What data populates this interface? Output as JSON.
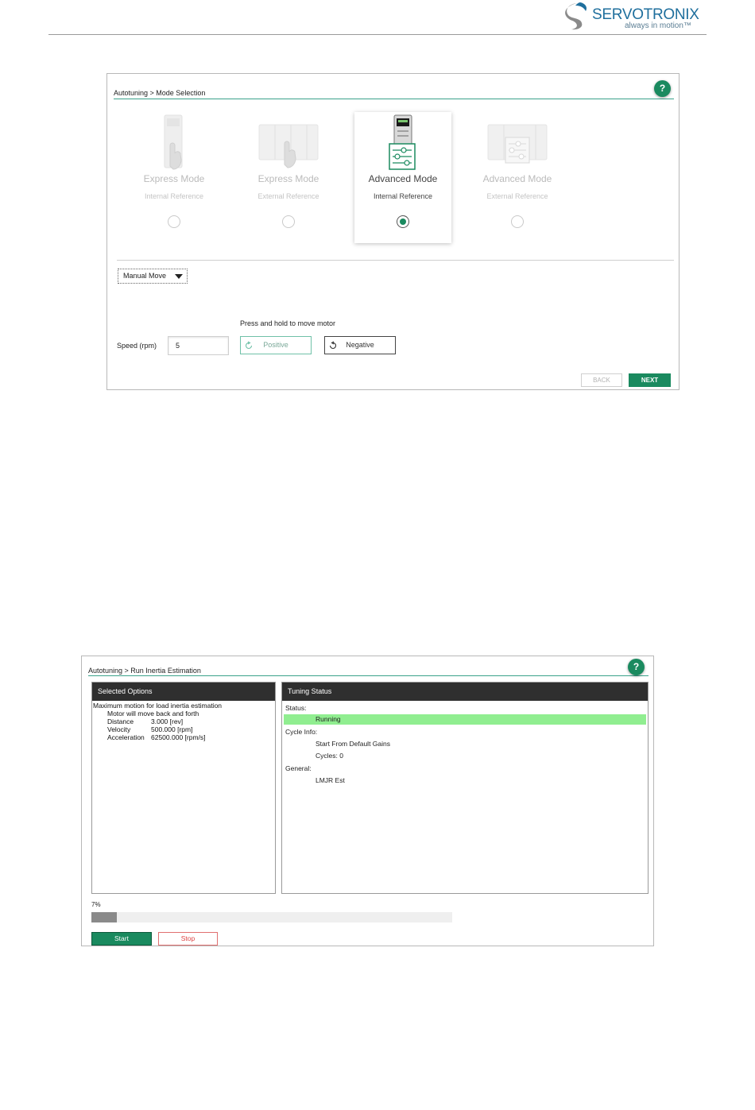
{
  "header": {
    "brand_name": "SERVOTRONIX",
    "tagline": "always in motion™",
    "brand_color": "#1f6f9d"
  },
  "mode_selection": {
    "breadcrumb": "Autotuning > Mode Selection",
    "help_label": "?",
    "modes": [
      {
        "title": "Express Mode",
        "subtitle": "Internal Reference",
        "selected": false
      },
      {
        "title": "Express Mode",
        "subtitle": "External Reference",
        "selected": false
      },
      {
        "title": "Advanced Mode",
        "subtitle": "Internal Reference",
        "selected": true
      },
      {
        "title": "Advanced Mode",
        "subtitle": "External Reference",
        "selected": false
      }
    ],
    "motion_dropdown": "Manual Move",
    "hint": "Press and hold to move motor",
    "speed_label": "Speed (rpm)",
    "speed_value": "5",
    "positive_label": "Positive",
    "negative_label": "Negative",
    "back_label": "BACK",
    "next_label": "NEXT",
    "accent_color": "#1a8a5f"
  },
  "inertia": {
    "breadcrumb": "Autotuning > Run Inertia Estimation",
    "help_label": "?",
    "selected_options": {
      "title": "Selected Options",
      "heading": "Maximum motion for load inertia estimation",
      "note": "Motor will move back and forth",
      "rows": [
        {
          "label": "Distance",
          "value": "3.000 [rev]"
        },
        {
          "label": "Velocity",
          "value": "500.000 [rpm]"
        },
        {
          "label": "Acceleration",
          "value": "62500.000 [rpm/s]"
        }
      ]
    },
    "tuning_status": {
      "title": "Tuning Status",
      "status_label": "Status:",
      "status_value": "Running",
      "cycle_label": "Cycle Info:",
      "cycle_start": "Start From Default Gains",
      "cycles": "Cycles: 0",
      "general_label": "General:",
      "general_value": "LMJR Est",
      "status_color": "#90ee90"
    },
    "progress_text": "7%",
    "progress_fraction": 0.07,
    "start_label": "Start",
    "stop_label": "Stop"
  }
}
